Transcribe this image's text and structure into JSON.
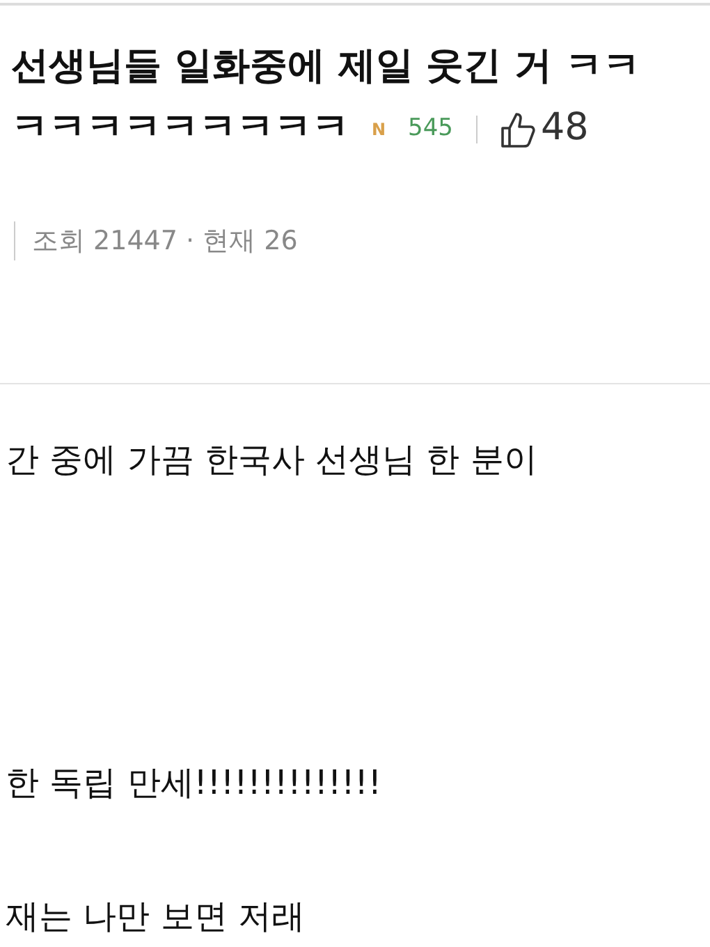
{
  "post": {
    "title_lines": [
      "선생님들 일화중에 제일 웃긴 거 ㅋㅋ",
      "ㅋㅋㅋㅋㅋㅋㅋㅋㅋ"
    ],
    "new_badge": "N",
    "comment_count": "545",
    "likes": "48",
    "views": "조회 21447 · 현재 26"
  },
  "body": [
    "간 중에 가끔 한국사 선생님 한 분이",
    "한 독립 만세!!!!!!!!!!!!!!",
    "재는 나만 보면 저래"
  ]
}
